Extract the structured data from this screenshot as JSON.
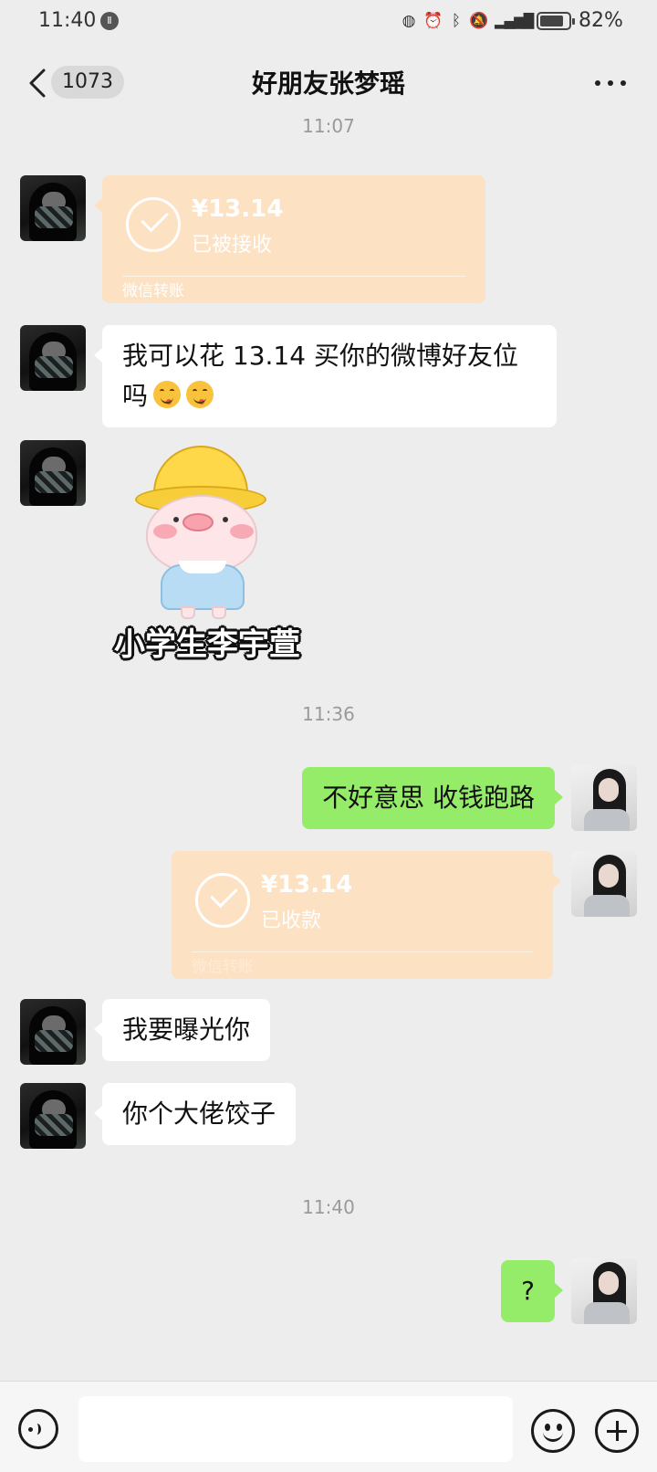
{
  "status_bar": {
    "time": "11:40",
    "battery": "82%",
    "battery_level": 0.82,
    "icons": [
      "notification-badge-icon",
      "alarm-icon",
      "bluetooth-icon",
      "mute-icon",
      "signal-icon"
    ]
  },
  "header": {
    "unread_count": "1073",
    "title": "好朋友张梦瑶"
  },
  "messages": [
    {
      "type": "timestamp",
      "text": "11:07"
    },
    {
      "type": "transfer",
      "side": "left",
      "amount": "¥13.14",
      "status": "已被接收",
      "footer": "微信转账"
    },
    {
      "type": "text",
      "side": "left",
      "text": "我可以花 13.14 买你的微博好友位吗"
    },
    {
      "type": "sticker",
      "side": "left",
      "caption": "小学生李宇萱"
    },
    {
      "type": "timestamp",
      "text": "11:36"
    },
    {
      "type": "text",
      "side": "right",
      "text": "不好意思 收钱跑路"
    },
    {
      "type": "transfer",
      "side": "right",
      "amount": "¥13.14",
      "status": "已收款",
      "footer": "微信转账"
    },
    {
      "type": "text",
      "side": "left",
      "text": "我要曝光你"
    },
    {
      "type": "text",
      "side": "left",
      "text": "你个大佬饺子"
    },
    {
      "type": "timestamp",
      "text": "11:40"
    },
    {
      "type": "text",
      "side": "right",
      "text": "?"
    }
  ],
  "colors": {
    "background": "#ededed",
    "bubble_self": "#95ec69",
    "bubble_other": "#ffffff",
    "transfer_card": "#fde1c3"
  }
}
